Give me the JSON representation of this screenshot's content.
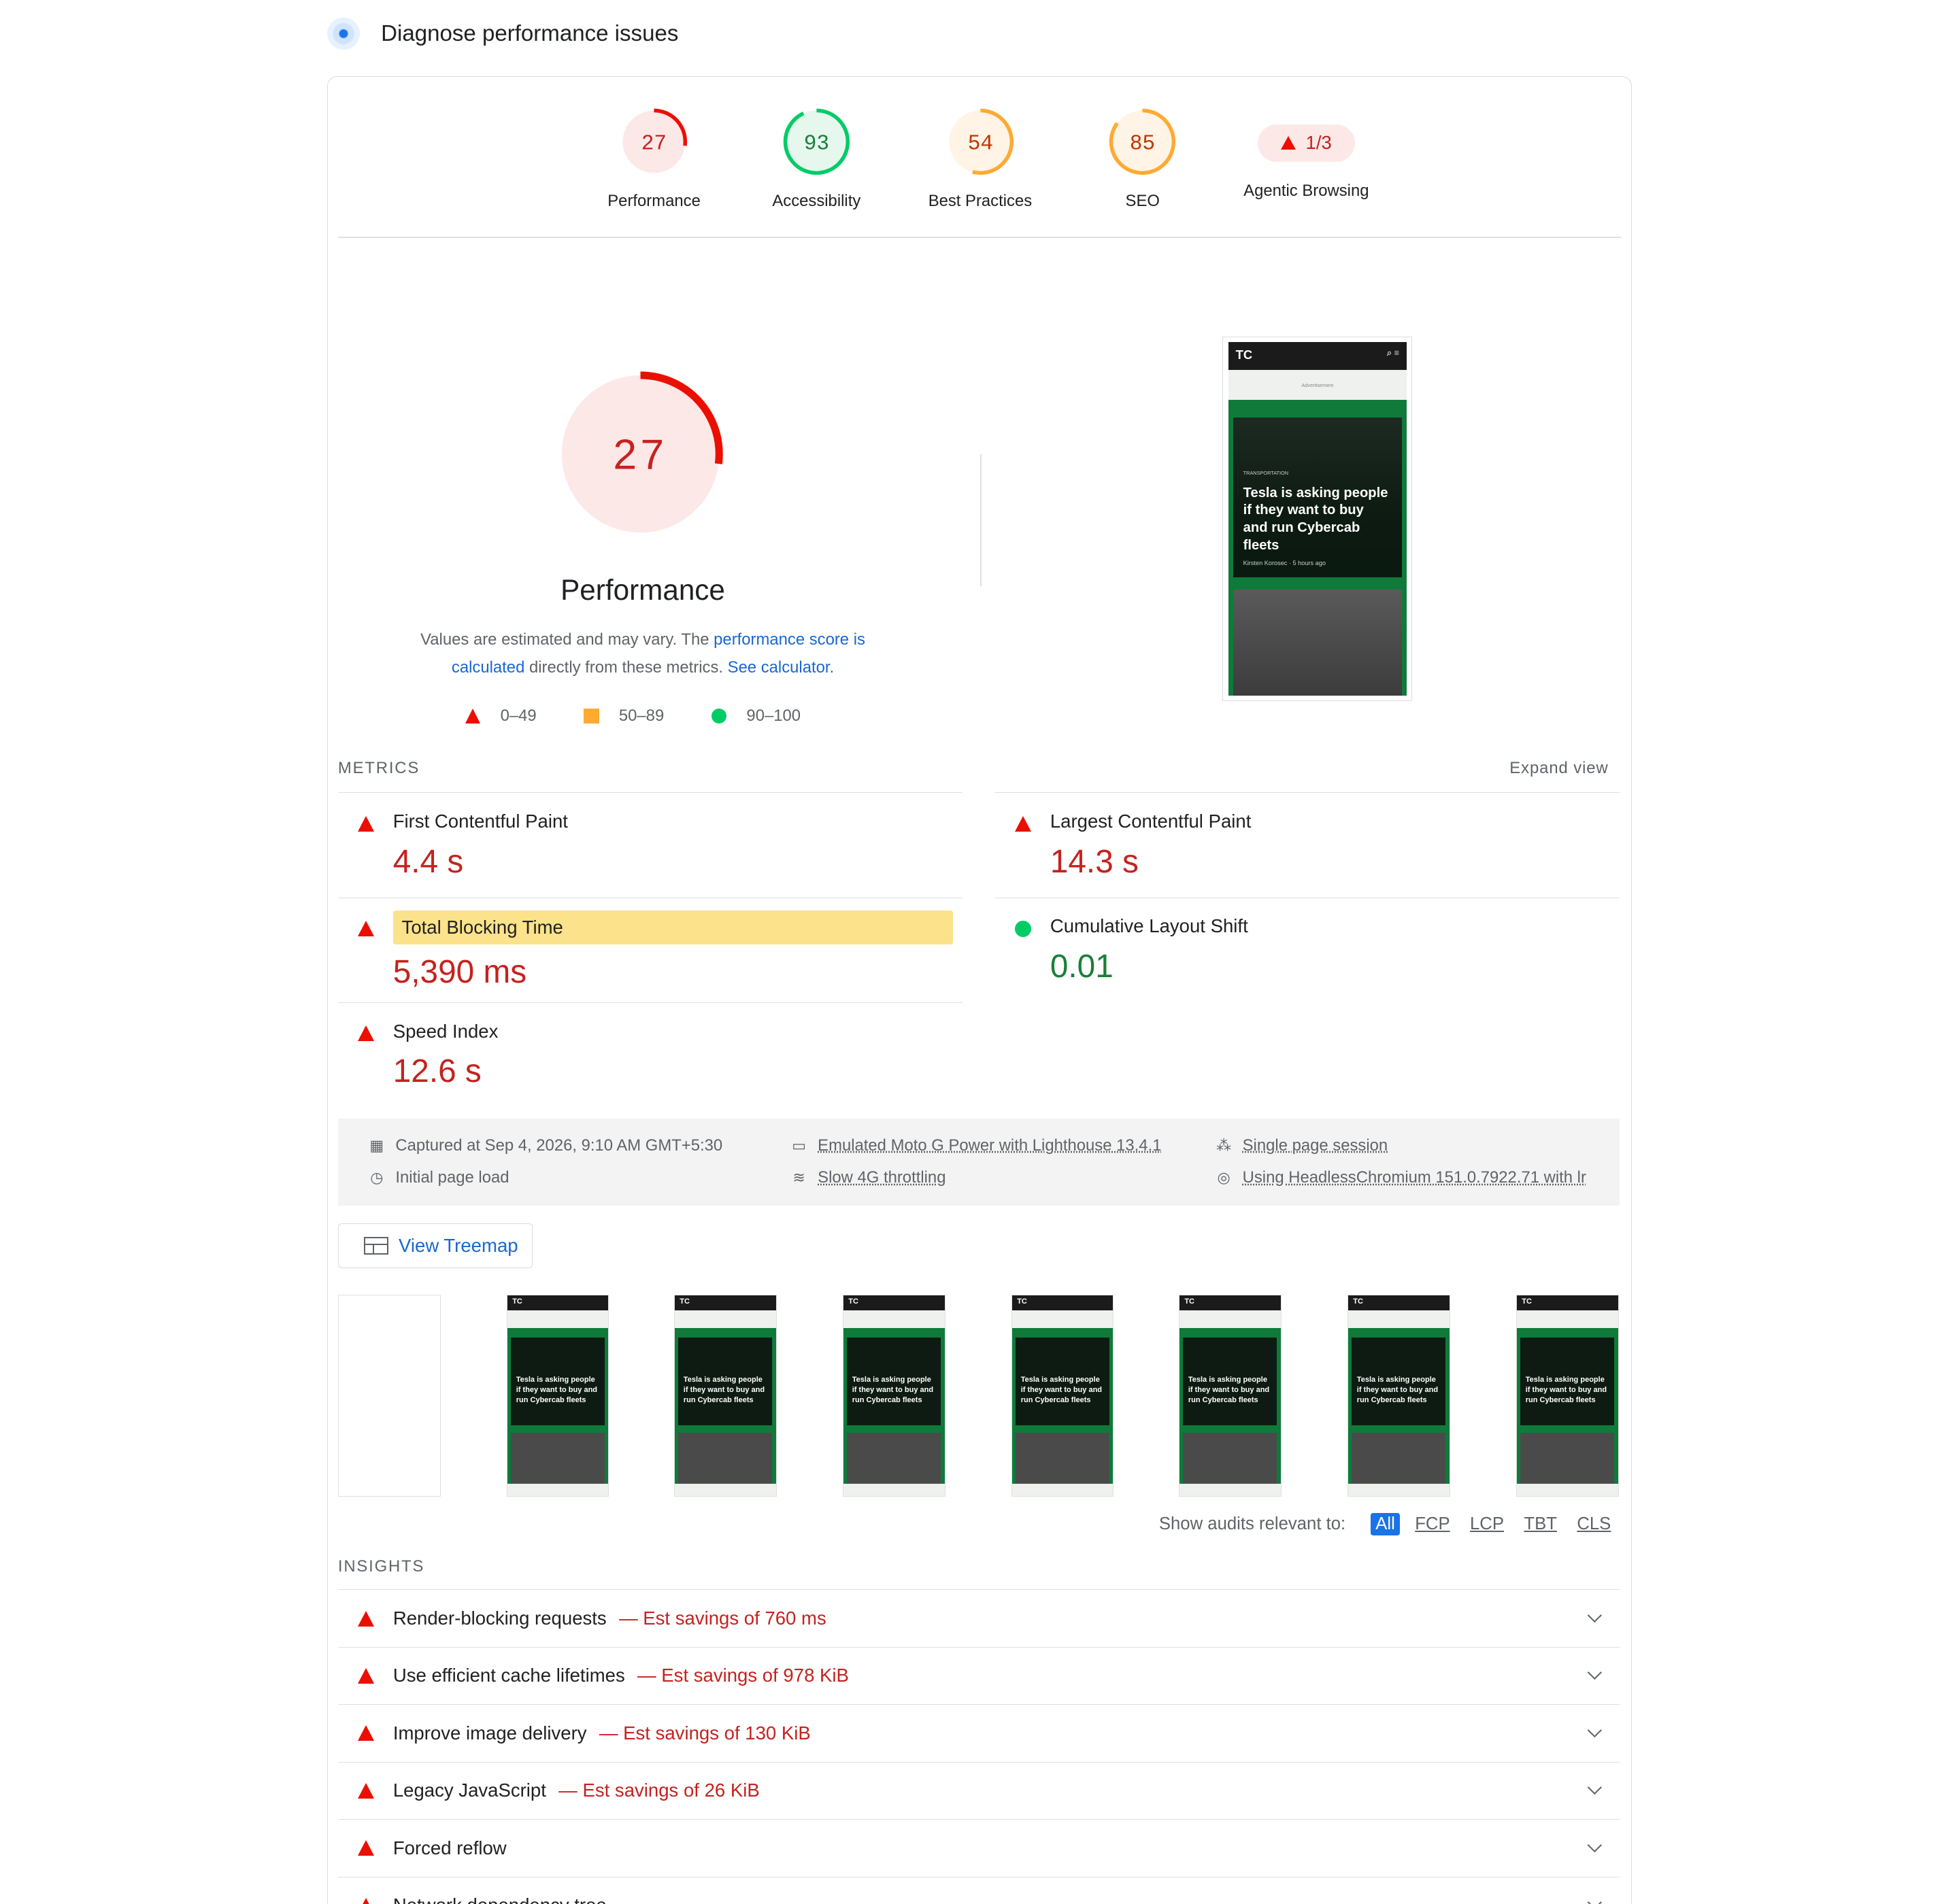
{
  "header": {
    "title": "Diagnose performance issues",
    "icon": "lighthouse-icon"
  },
  "categories": [
    {
      "score": "27",
      "label": "Performance",
      "fraction": 0.27,
      "color": "#eb0f00",
      "bg": "#fde8e8"
    },
    {
      "score": "93",
      "label": "Accessibility",
      "fraction": 0.93,
      "color": "#0c6",
      "bg": "#e6f8ee"
    },
    {
      "score": "54",
      "label": "Best Practices",
      "fraction": 0.54,
      "color": "#fa3",
      "bg": "#fff4e5"
    },
    {
      "score": "85",
      "label": "SEO",
      "fraction": 0.85,
      "color": "#fa3",
      "bg": "#fff4e5"
    },
    {
      "score": "1/3",
      "label": "Agentic Browsing"
    }
  ],
  "performance": {
    "score": "27",
    "fraction": 0.27,
    "title": "Performance",
    "desc_prefix": "Values are estimated and may vary. The ",
    "desc_link": "performance score is calculated",
    "desc_middle": " directly from these metrics. ",
    "desc_calc": "See calculator.",
    "legend": [
      "0–49",
      "50–89",
      "90–100"
    ]
  },
  "screenshot": {
    "logo": "TC",
    "ad": "Advertisement",
    "tag": "TRANSPORTATION",
    "headline": "Tesla is asking people if they want to buy and run Cybercab fleets",
    "byline": "Kirsten Korosec · 5 hours ago"
  },
  "metrics": {
    "title": "METRICS",
    "expand": "Expand view",
    "items": [
      {
        "name": "First Contentful Paint",
        "value": "4.4 s",
        "rating": "fail"
      },
      {
        "name": "Largest Contentful Paint",
        "value": "14.3 s",
        "rating": "fail"
      },
      {
        "name": "Total Blocking Time",
        "value": "5,390 ms",
        "rating": "fail"
      },
      {
        "name": "Cumulative Layout Shift",
        "value": "0.01",
        "rating": "pass"
      },
      {
        "name": "Speed Index",
        "value": "12.6 s",
        "rating": "fail"
      }
    ]
  },
  "runtime": {
    "captured": "Captured at Sep 4, 2026, 9:10 AM GMT+5:30",
    "initial": "Initial page load",
    "device": "Emulated Moto G Power with Lighthouse 13.4.1",
    "network": "Slow 4G throttling",
    "session": "Single page session",
    "browser": "Using HeadlessChromium 151.0.7922.71 with lr"
  },
  "treemap": {
    "label": "View Treemap"
  },
  "filmstrip": {
    "frame_headline": "Tesla is asking people if they want to buy and run Cybercab fleets"
  },
  "filters": {
    "label": "Show audits relevant to:",
    "chips": [
      "All",
      "FCP",
      "LCP",
      "TBT",
      "CLS"
    ]
  },
  "insights": {
    "title": "INSIGHTS",
    "items": [
      {
        "title": "Render-blocking requests",
        "savings": "— Est savings of 760 ms"
      },
      {
        "title": "Use efficient cache lifetimes",
        "savings": "— Est savings of 978 KiB"
      },
      {
        "title": "Improve image delivery",
        "savings": "— Est savings of 130 KiB"
      },
      {
        "title": "Legacy JavaScript",
        "savings": "— Est savings of 26 KiB"
      },
      {
        "title": "Forced reflow",
        "savings": ""
      },
      {
        "title": "Network dependency tree",
        "savings": ""
      }
    ]
  }
}
